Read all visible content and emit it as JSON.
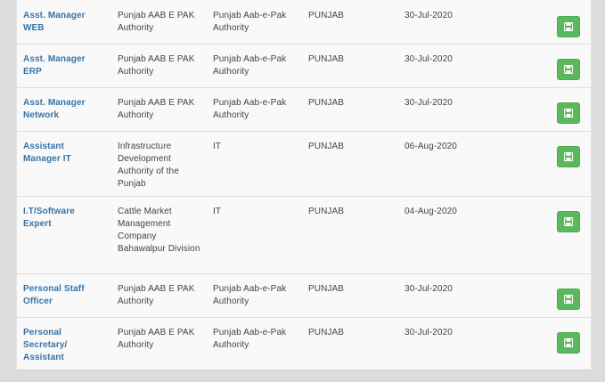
{
  "jobs": [
    {
      "title": "Asst. Manager WEB",
      "organization": "Punjab AAB E PAK Authority",
      "department": "Punjab Aab-e-Pak Authority",
      "province": "PUNJAB",
      "date": "30-Jul-2020",
      "action_icon": "save-icon"
    },
    {
      "title": "Asst. Manager ERP",
      "organization": "Punjab AAB E PAK Authority",
      "department": "Punjab Aab-e-Pak Authority",
      "province": "PUNJAB",
      "date": "30-Jul-2020",
      "action_icon": "save-icon"
    },
    {
      "title": "Asst. Manager Network",
      "organization": "Punjab AAB E PAK Authority",
      "department": "Punjab Aab-e-Pak Authority",
      "province": "PUNJAB",
      "date": "30-Jul-2020",
      "action_icon": "save-icon"
    },
    {
      "title": "Assistant Manager IT",
      "organization": "Infrastructure Development Authority of the Punjab",
      "department": "IT",
      "province": "PUNJAB",
      "date": "06-Aug-2020",
      "action_icon": "save-icon"
    },
    {
      "title": "I.T/Software Expert",
      "organization": "Cattle Market Management Company Bahawalpur Division",
      "department": "IT",
      "province": "PUNJAB",
      "date": "04-Aug-2020",
      "action_icon": "save-icon"
    },
    {
      "title": "Personal Staff Officer",
      "organization": "Punjab AAB E PAK Authority",
      "department": "Punjab Aab-e-Pak Authority",
      "province": "PUNJAB",
      "date": "30-Jul-2020",
      "action_icon": "save-icon"
    },
    {
      "title": "Personal Secretary/ Assistant",
      "organization": "Punjab AAB E PAK Authority",
      "department": "Punjab Aab-e-Pak Authority",
      "province": "PUNJAB",
      "date": "30-Jul-2020",
      "action_icon": "save-icon"
    }
  ],
  "colors": {
    "title_link": "#3674a8",
    "save_button": "#5cb85c",
    "row_background": "#f9f9f9",
    "page_background": "#dcdcdc"
  }
}
